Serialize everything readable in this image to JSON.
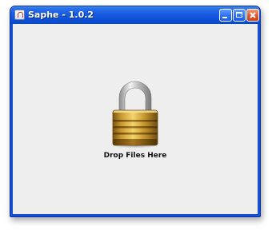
{
  "window": {
    "title": "Saphe - 1.0.2"
  },
  "titlebar": {
    "icons": {
      "app": "java-cup-icon",
      "minimize": "minimize-icon",
      "maximize": "maximize-icon",
      "close": "close-icon"
    }
  },
  "main": {
    "drop_label": "Drop Files Here",
    "lock_icon": "padlock-icon"
  },
  "colors": {
    "titlebar": "#1550d6",
    "close_button": "#e0572e",
    "client_background": "#eeeeee",
    "lock_body": "#c99a2e",
    "lock_shackle": "#c8c8c8"
  }
}
